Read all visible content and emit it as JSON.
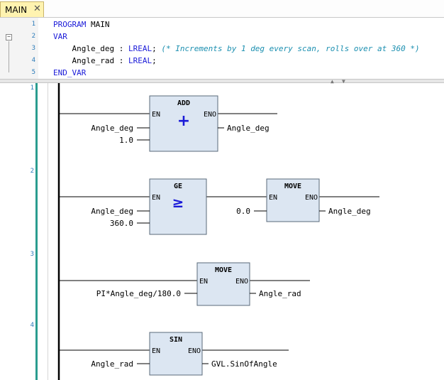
{
  "tab": {
    "label": "MAIN",
    "close": "✕"
  },
  "declaration": {
    "line_numbers": [
      "1",
      "2",
      "3",
      "4",
      "5"
    ],
    "collapse_symbol": "⊟",
    "lines": [
      {
        "indent": "",
        "tokens": [
          {
            "cls": "kw",
            "text": "PROGRAM "
          },
          {
            "cls": "id",
            "text": "MAIN"
          }
        ]
      },
      {
        "indent": "",
        "tokens": [
          {
            "cls": "kw",
            "text": "VAR"
          }
        ]
      },
      {
        "indent": "    ",
        "tokens": [
          {
            "cls": "id",
            "text": "Angle_deg : "
          },
          {
            "cls": "ty",
            "text": "LREAL"
          },
          {
            "cls": "id",
            "text": "; "
          },
          {
            "cls": "cm",
            "text": "(* Increments by 1 deg every scan, rolls over at 360 *)"
          }
        ]
      },
      {
        "indent": "    ",
        "tokens": [
          {
            "cls": "id",
            "text": "Angle_rad : "
          },
          {
            "cls": "ty",
            "text": "LREAL"
          },
          {
            "cls": "id",
            "text": ";"
          }
        ]
      },
      {
        "indent": "",
        "tokens": [
          {
            "cls": "kw",
            "text": "END_VAR"
          }
        ]
      }
    ]
  },
  "splitter": {
    "up_arrow": "▲",
    "down_arrow": "▼"
  },
  "networks": [
    {
      "number": "1",
      "block": {
        "name": "ADD",
        "symbol": "+",
        "en": "EN",
        "eno": "ENO",
        "inputs": [
          "Angle_deg",
          "1.0"
        ],
        "output": "Angle_deg"
      }
    },
    {
      "number": "2",
      "block": {
        "name": "GE",
        "symbol": "≥",
        "en": "EN",
        "eno": "ENO",
        "inputs": [
          "Angle_deg",
          "360.0"
        ]
      },
      "block2": {
        "name": "MOVE",
        "en": "EN",
        "eno": "ENO",
        "input": "0.0",
        "output": "Angle_deg"
      }
    },
    {
      "number": "3",
      "block": {
        "name": "MOVE",
        "en": "EN",
        "eno": "ENO",
        "input": "PI*Angle_deg/180.0",
        "output": "Angle_rad"
      }
    },
    {
      "number": "4",
      "block": {
        "name": "SIN",
        "en": "EN",
        "eno": "ENO",
        "input": "Angle_rad",
        "output": "GVL.SinOfAngle"
      }
    }
  ]
}
